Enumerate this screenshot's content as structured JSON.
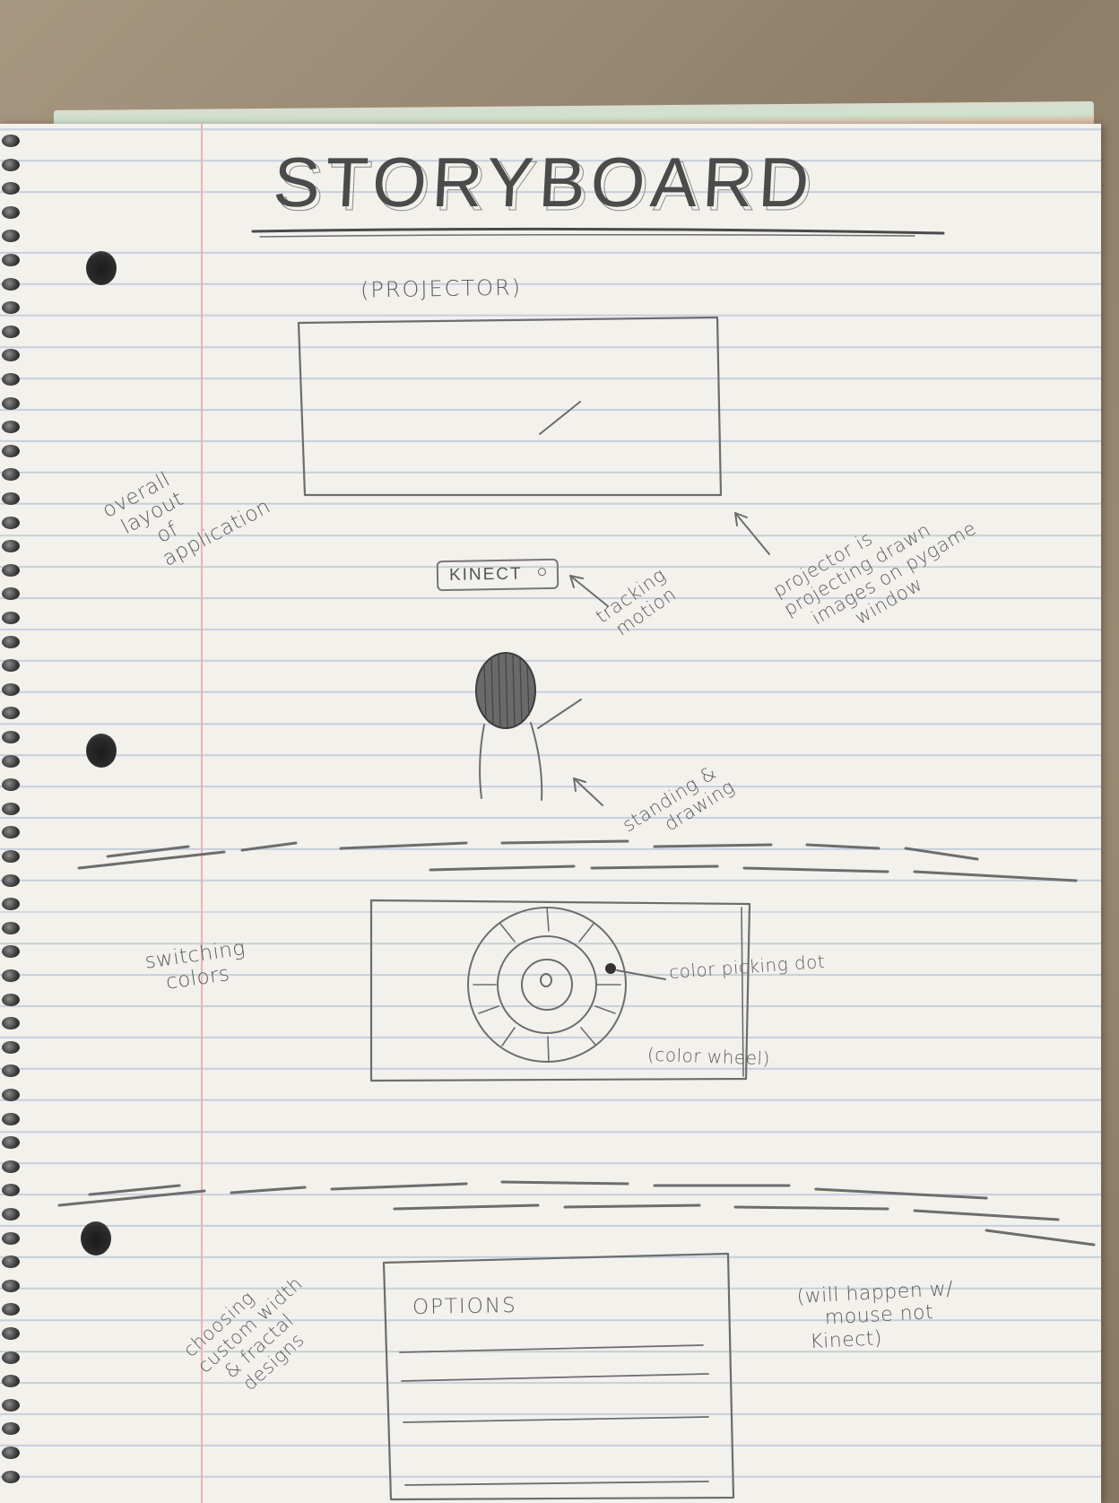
{
  "title": "STORYBOARD",
  "panel1": {
    "projector_label": "(PROJECTOR)",
    "kinect_label": "KINECT",
    "side_note": [
      "overall",
      "layout",
      "of",
      "application"
    ],
    "tracking_note": [
      "tracking",
      "motion"
    ],
    "projector_note": [
      "projector is",
      "projecting drawn",
      "images on pygame",
      "window"
    ],
    "standing_note": [
      "standing &",
      "drawing"
    ]
  },
  "panel2": {
    "side_note": [
      "switching",
      "colors"
    ],
    "dot_note": "color picking dot",
    "wheel_note": "(color wheel)"
  },
  "panel3": {
    "side_note": [
      "choosing",
      "custom width",
      "& fractal",
      "designs"
    ],
    "options_label": "OPTIONS",
    "mouse_note": [
      "(will happen w/",
      "mouse not",
      "Kinect)"
    ]
  }
}
